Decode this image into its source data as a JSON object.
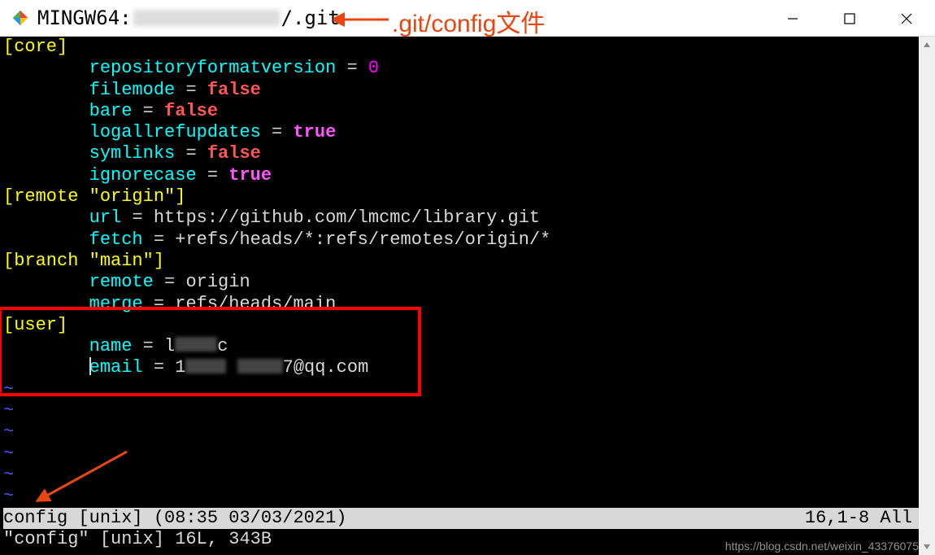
{
  "window": {
    "title_prefix": "MINGW64:",
    "title_suffix": "/.git"
  },
  "annotation": {
    "text": ".git/config文件"
  },
  "config": {
    "core": {
      "section": "[core]",
      "repositoryformatversion": {
        "key": "repositoryformatversion",
        "value": "0"
      },
      "filemode": {
        "key": "filemode",
        "value": "false"
      },
      "bare": {
        "key": "bare",
        "value": "false"
      },
      "logallrefupdates": {
        "key": "logallrefupdates",
        "value": "true"
      },
      "symlinks": {
        "key": "symlinks",
        "value": "false"
      },
      "ignorecase": {
        "key": "ignorecase",
        "value": "true"
      }
    },
    "remote": {
      "section": "[remote \"origin\"]",
      "url": {
        "key": "url",
        "value": "https://github.com/lmcmc/library.git"
      },
      "fetch": {
        "key": "fetch",
        "value": "+refs/heads/*:refs/remotes/origin/*"
      }
    },
    "branch": {
      "section": "[branch \"main\"]",
      "remote": {
        "key": "remote",
        "value": "origin"
      },
      "merge": {
        "key": "merge",
        "value": "refs/heads/main"
      }
    },
    "user": {
      "section": "[user]",
      "name": {
        "key": "name",
        "prefix": "l",
        "suffix": "c"
      },
      "email": {
        "key": "email",
        "prefix": "1",
        "suffix": "7@qq.com"
      }
    }
  },
  "equals": " = ",
  "indent": "        ",
  "status": {
    "left": "config [unix] (08:35 03/03/2021)",
    "right": "16,1-8 All"
  },
  "message": "\"config\" [unix] 16L, 343B",
  "watermark": "https://blog.csdn.net/weixin_43376075"
}
